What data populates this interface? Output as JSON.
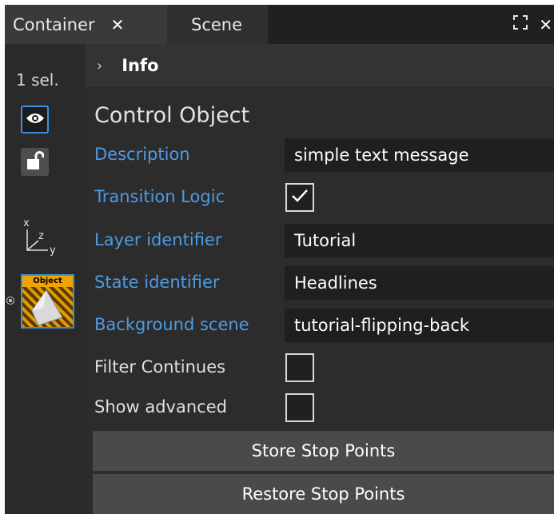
{
  "tabs": [
    {
      "label": "Container",
      "close": "✕"
    },
    {
      "label": "Scene"
    }
  ],
  "window_tools": {
    "maximize": "⛶",
    "close": "✕"
  },
  "sidebar": {
    "selection_count": "1 sel.",
    "axes": {
      "x": "x",
      "z": "z",
      "y": "y"
    },
    "object_thumb_label": "Object"
  },
  "panel": {
    "header_chevron": "›",
    "header_title": "Info",
    "section_title": "Control Object",
    "fields": {
      "description": {
        "label": "Description",
        "value": "simple text message"
      },
      "transition_logic": {
        "label": "Transition Logic",
        "checked": true
      },
      "layer_identifier": {
        "label": "Layer identifier",
        "value": "Tutorial"
      },
      "state_identifier": {
        "label": "State identifier",
        "value": "Headlines"
      },
      "background_scene": {
        "label": "Background scene",
        "value": "tutorial-flipping-back"
      },
      "filter_continues": {
        "label": "Filter Continues",
        "checked": false
      },
      "show_advanced": {
        "label": "Show advanced",
        "checked": false
      }
    },
    "buttons": {
      "store": "Store Stop Points",
      "restore": "Restore Stop Points"
    }
  },
  "colors": {
    "link_label": "#4d9be6",
    "accent_border": "#3d8fd8",
    "field_bg": "#1f1f1f",
    "button_bg": "#4a4a4a"
  }
}
